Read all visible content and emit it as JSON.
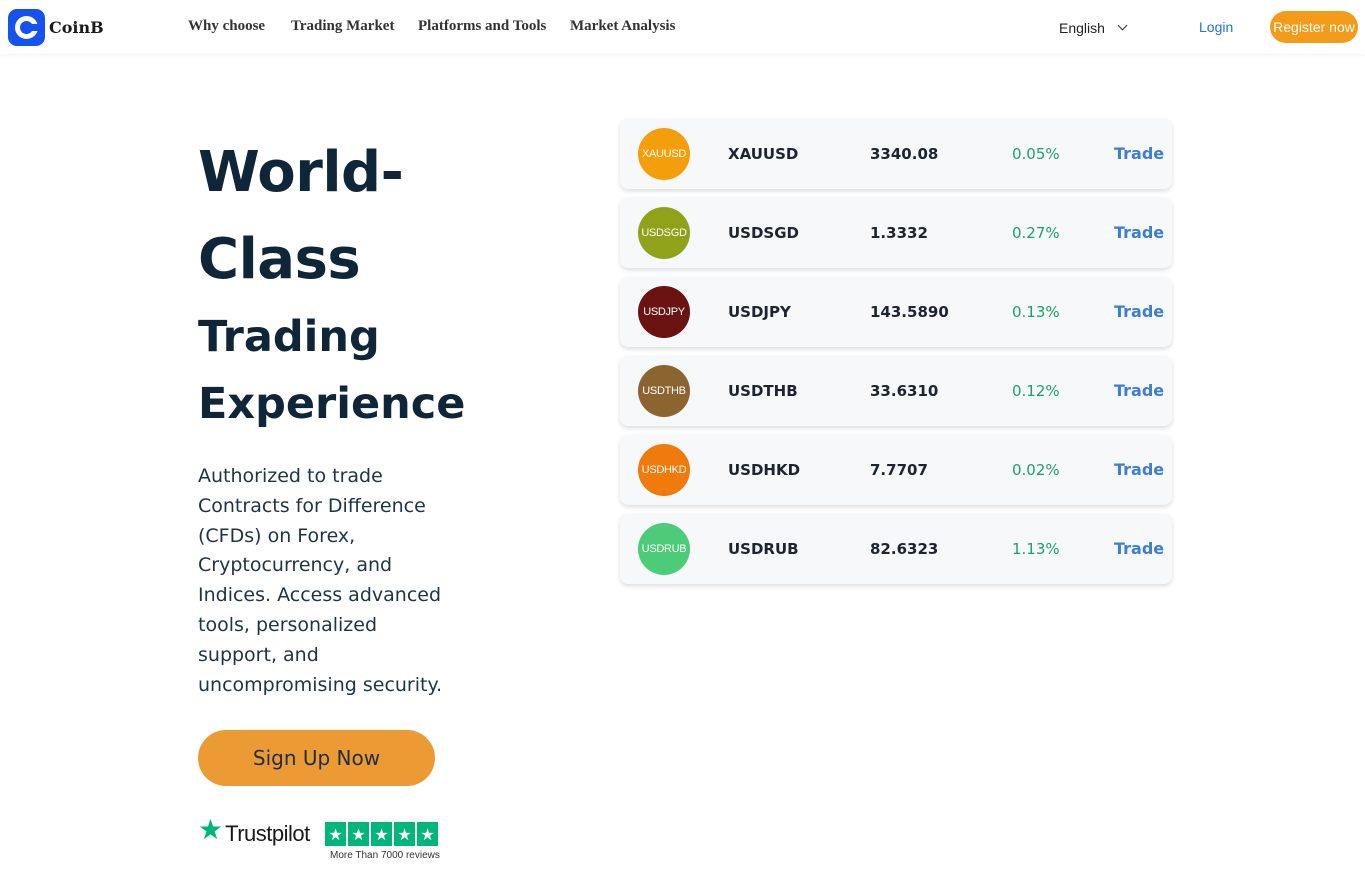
{
  "header": {
    "brand": "CoinB",
    "nav": [
      "Why choose",
      "Trading Market",
      "Platforms and Tools",
      "Market Analysis"
    ],
    "language": "English",
    "login_label": "Login",
    "register_label": "Register now"
  },
  "hero": {
    "title_line1": "World-",
    "title_line2": "Class",
    "title_line3": "Trading",
    "title_line4": "Experience",
    "description": "Authorized to trade Contracts for Difference (CFDs) on Forex, Cryptocurrency, and Indices. Access advanced tools, personalized support, and uncompromising security.",
    "cta_label": "Sign Up Now",
    "trustpilot_label": "Trustpilot",
    "trustpilot_rating": 5,
    "trustpilot_sub": "More Than 7000 reviews"
  },
  "markets": [
    {
      "symbol": "XAUUSD",
      "price": "3340.08",
      "change": "0.05%",
      "action": "Trade",
      "color": "#f59e0b"
    },
    {
      "symbol": "USDSGD",
      "price": "1.3332",
      "change": "0.27%",
      "action": "Trade",
      "color": "#8fa21a"
    },
    {
      "symbol": "USDJPY",
      "price": "143.5890",
      "change": "0.13%",
      "action": "Trade",
      "color": "#6b1313"
    },
    {
      "symbol": "USDTHB",
      "price": "33.6310",
      "change": "0.12%",
      "action": "Trade",
      "color": "#8c6430"
    },
    {
      "symbol": "USDHKD",
      "price": "7.7707",
      "change": "0.02%",
      "action": "Trade",
      "color": "#f07a0c"
    },
    {
      "symbol": "USDRUB",
      "price": "82.6323",
      "change": "1.13%",
      "action": "Trade",
      "color": "#4ccc78"
    }
  ],
  "colors": {
    "brand_blue": "#1652f0",
    "register_orange": "#f59b1a",
    "cta_orange": "#ec9a34",
    "positive_green": "#1aa26a",
    "link_blue": "#3b7dd8",
    "trustpilot_green": "#00b67a"
  }
}
